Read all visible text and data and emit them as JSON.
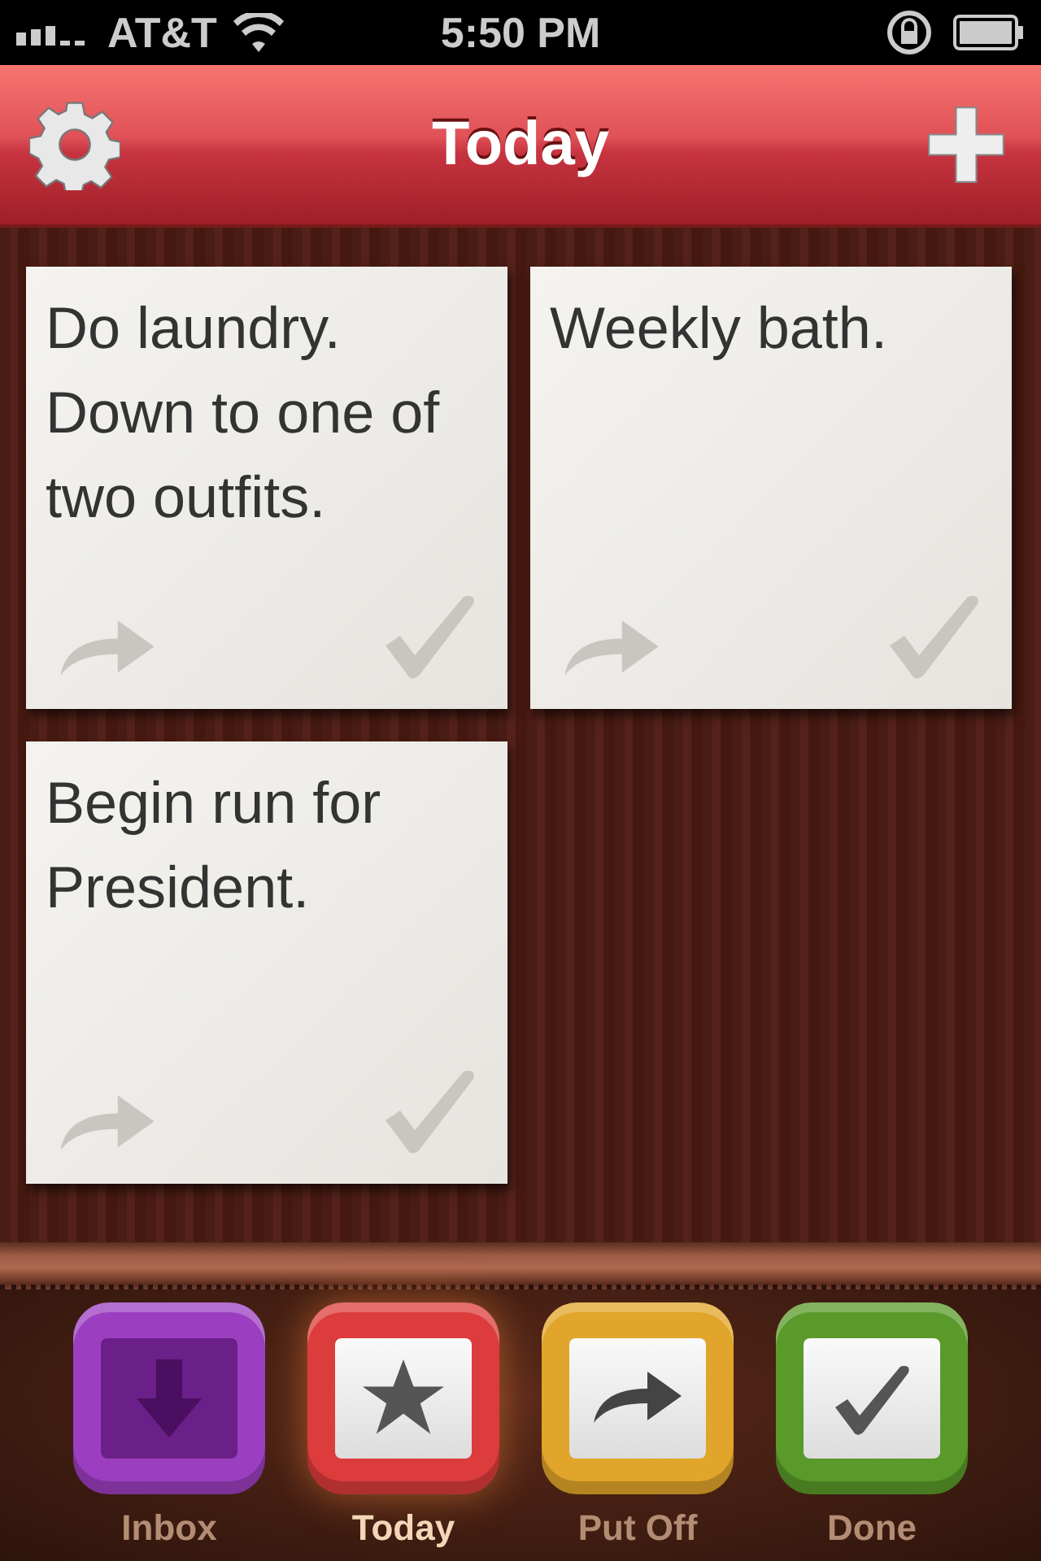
{
  "status_bar": {
    "carrier": "AT&T",
    "time": "5:50 PM"
  },
  "nav": {
    "title": "Today"
  },
  "tasks": [
    {
      "text": "Do laundry. Down to one of two outfits."
    },
    {
      "text": "Weekly bath."
    },
    {
      "text": "Begin run for President."
    }
  ],
  "tabs": [
    {
      "label": "Inbox",
      "kind": "inbox",
      "color": "#9b3fc0",
      "selected": false
    },
    {
      "label": "Today",
      "kind": "today",
      "color": "#dc3c3c",
      "selected": true
    },
    {
      "label": "Put Off",
      "kind": "putoff",
      "color": "#e0a52a",
      "selected": false
    },
    {
      "label": "Done",
      "kind": "done",
      "color": "#5a9a2a",
      "selected": false
    }
  ]
}
